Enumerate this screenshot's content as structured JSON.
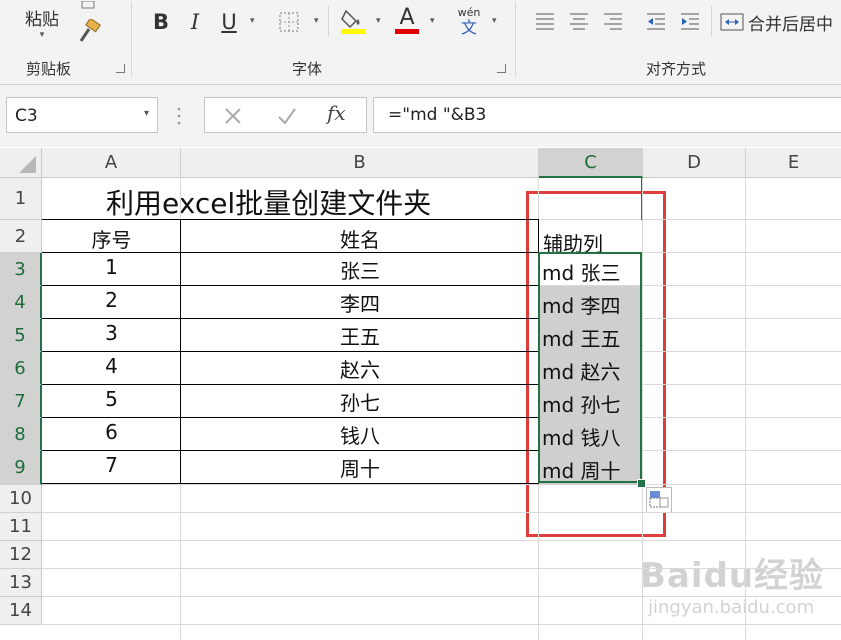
{
  "ribbon": {
    "clipboard": {
      "paste_label": "粘贴",
      "group_label": "剪贴板"
    },
    "font": {
      "group_label": "字体",
      "bold": "B",
      "italic": "I",
      "underline": "U",
      "font_color_glyph": "A",
      "phonetic_top": "wén",
      "phonetic_bottom": "文"
    },
    "alignment": {
      "group_label": "对齐方式",
      "merge_label": "合并后居中"
    },
    "colors": {
      "highlight": "#ffff00",
      "font_color": "#e00000"
    }
  },
  "formula_bar": {
    "name_box": "C3",
    "fx_label": "fx",
    "formula": "=\"md \"&B3"
  },
  "columns": [
    "A",
    "B",
    "C",
    "D",
    "E"
  ],
  "rows": [
    "1",
    "2",
    "3",
    "4",
    "5",
    "6",
    "7",
    "8",
    "9",
    "10",
    "11",
    "12",
    "13",
    "14"
  ],
  "sheet": {
    "title": "利用excel批量创建文件夹",
    "header_seq": "序号",
    "header_name": "姓名",
    "header_helper": "辅助列",
    "records": [
      {
        "seq": "1",
        "name": "张三",
        "helper": "md 张三"
      },
      {
        "seq": "2",
        "name": "李四",
        "helper": "md 李四"
      },
      {
        "seq": "3",
        "name": "王五",
        "helper": "md 王五"
      },
      {
        "seq": "4",
        "name": "赵六",
        "helper": "md 赵六"
      },
      {
        "seq": "5",
        "name": "孙七",
        "helper": "md 孙七"
      },
      {
        "seq": "6",
        "name": "钱八",
        "helper": "md 钱八"
      },
      {
        "seq": "7",
        "name": "周十",
        "helper": "md 周十"
      }
    ]
  },
  "watermark": {
    "brand": "Baidu经验",
    "url": "jingyan.baidu.com"
  },
  "theme": {
    "accent": "#217346",
    "annotation": "#e03c3c"
  }
}
